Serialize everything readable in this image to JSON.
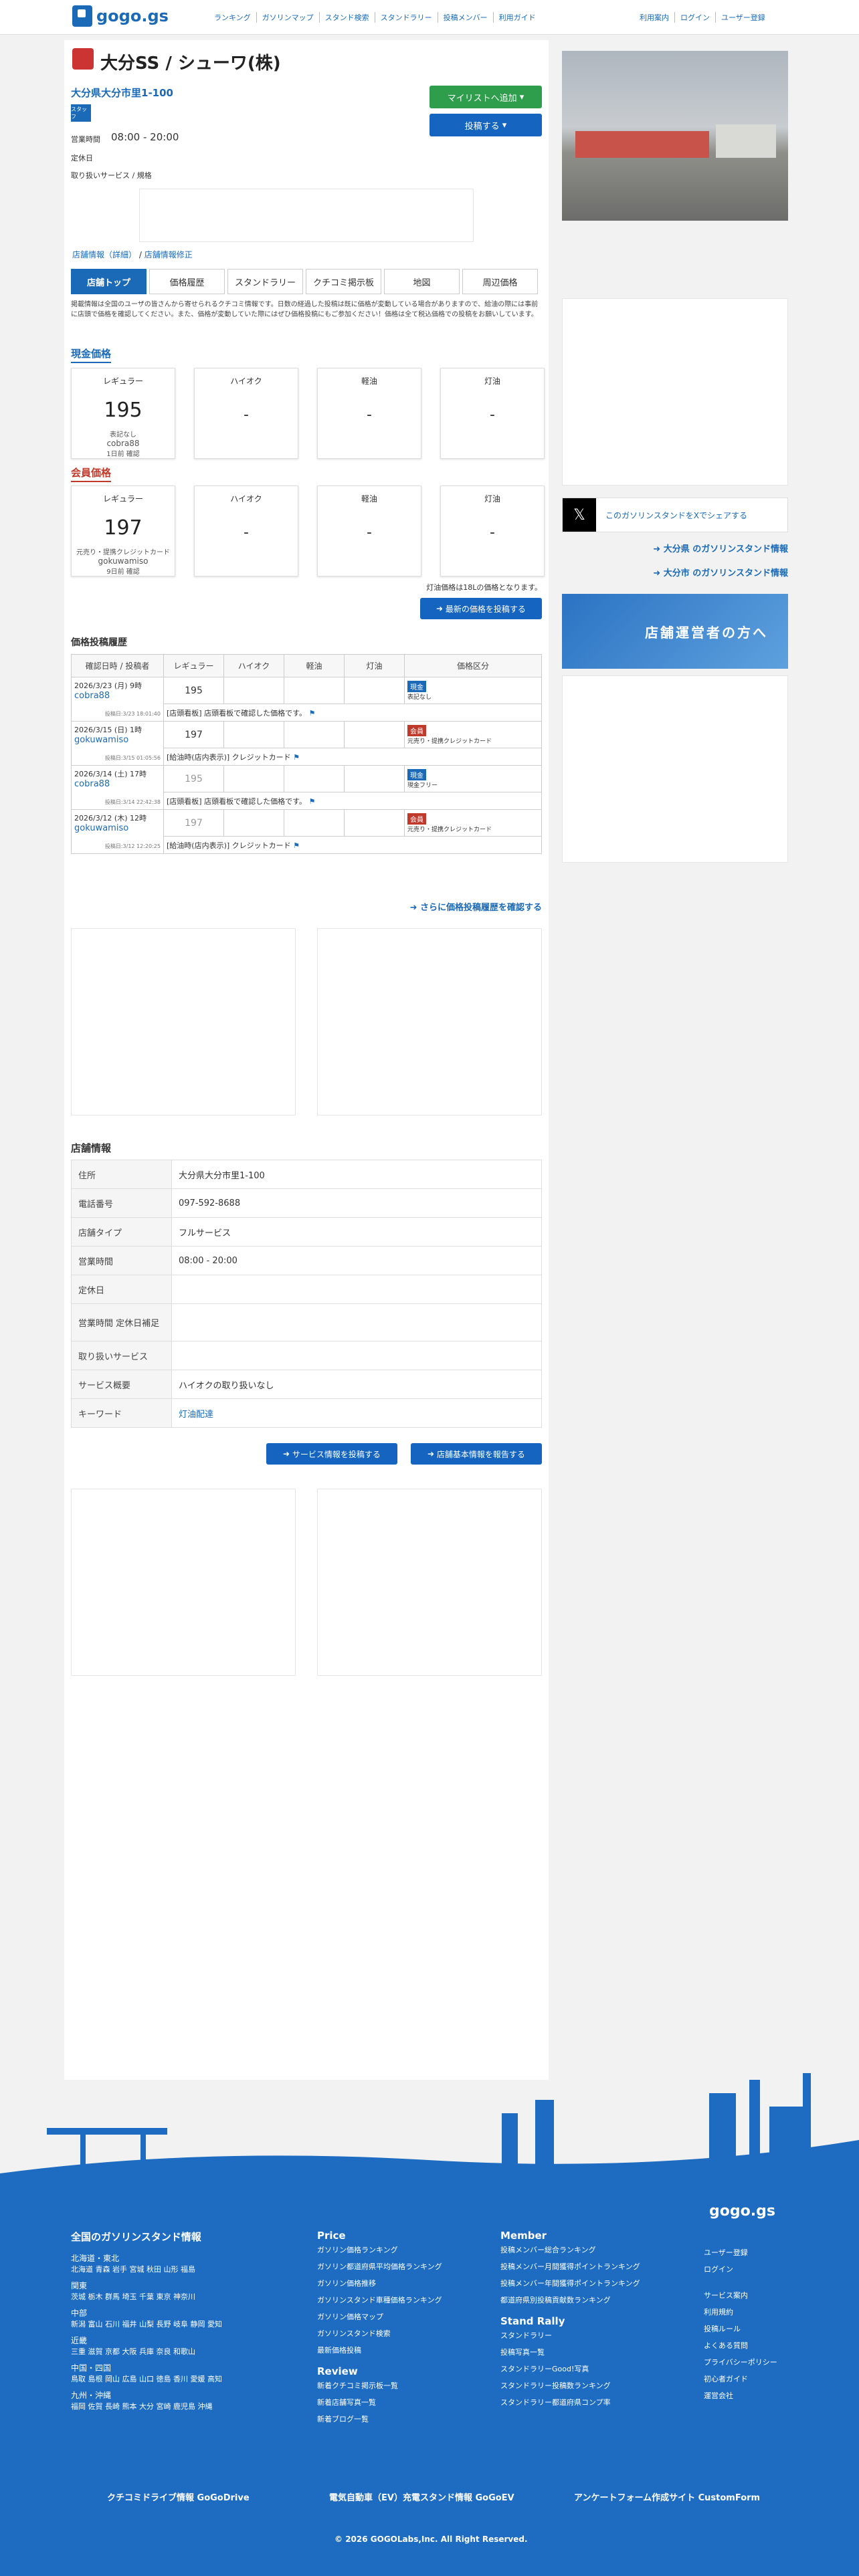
{
  "header": {
    "logo": "gogo.gs",
    "nav": [
      "ランキング",
      "ガソリンマップ",
      "スタンド検索",
      "スタンドラリー",
      "投稿メンバー",
      "利用ガイド"
    ],
    "right": [
      "利用案内",
      "ログイン",
      "ユーザー登録"
    ]
  },
  "station": {
    "name": "大分SS / シューワ(株)",
    "address": "大分県大分市里1-100",
    "hours_label": "営業時間",
    "hours": "08:00 - 20:00",
    "closed_label": "定休日",
    "services_label": "取り扱いサービス / 規格",
    "self_badge": "スタッフ"
  },
  "buttons": {
    "mylist": "マイリストへ追加",
    "post": "投稿する"
  },
  "breadcrumb": [
    "店舗情報（詳細）",
    "店舗情報修正"
  ],
  "tabs": [
    "店舗トップ",
    "価格履歴",
    "スタンドラリー",
    "クチコミ掲示板",
    "地図",
    "周辺価格"
  ],
  "notice": "掲載情報は全国のユーザの皆さんから寄せられるクチコミ情報です。日数の経過した投稿は既に価格が変動している場合がありますので、給油の際には事前に店頭で価格を確認してください。また、価格が変動していた際にはぜひ価格投稿にもご参加ください！価格は全て税込価格での投稿をお願いしています。",
  "cash": {
    "title": "現金価格",
    "cards": [
      {
        "label": "レギュラー",
        "price": "195",
        "note": "表記なし",
        "user": "cobra88",
        "when": "1日前 確認"
      },
      {
        "label": "ハイオク",
        "price": "-"
      },
      {
        "label": "軽油",
        "price": "-"
      },
      {
        "label": "灯油",
        "price": "-"
      }
    ]
  },
  "member": {
    "title": "会員価格",
    "cards": [
      {
        "label": "レギュラー",
        "price": "197",
        "note": "元売り・提携クレジットカード",
        "user": "gokuwamiso",
        "when": "9日前 確認"
      },
      {
        "label": "ハイオク",
        "price": "-"
      },
      {
        "label": "軽油",
        "price": "-"
      },
      {
        "label": "灯油",
        "price": "-"
      }
    ]
  },
  "kerosene_note": "灯油価格は18Lの価格となります。",
  "post_latest": "最新の価格を投稿する",
  "history": {
    "title": "価格投稿履歴",
    "headers": [
      "確認日時 / 投稿者",
      "レギュラー",
      "ハイオク",
      "軽油",
      "灯油",
      "価格区分"
    ],
    "rows": [
      {
        "date": "2026/3/23 (月) 9時",
        "user": "cobra88",
        "posted": "投稿日:3/23 18:01:40",
        "reg": "195",
        "badge": "現金",
        "btype": "blue",
        "bnote": "表記なし",
        "comment": "[店頭看板] 店頭看板で確認した価格です。"
      },
      {
        "date": "2026/3/15 (日) 1時",
        "user": "gokuwamiso",
        "posted": "投稿日:3/15 01:05:56",
        "reg": "197",
        "badge": "会員",
        "btype": "red",
        "bnote": "元売り・提携クレジットカード",
        "comment": "[給油時(店内表示)] クレジットカード"
      },
      {
        "date": "2026/3/14 (土) 17時",
        "user": "cobra88",
        "posted": "投稿日:3/14 22:42:38",
        "reg": "195",
        "badge": "現金",
        "btype": "blue",
        "bnote": "現金フリー",
        "comment": "[店頭看板] 店頭看板で確認した価格です。"
      },
      {
        "date": "2026/3/12 (木) 12時",
        "user": "gokuwamiso",
        "posted": "投稿日:3/12 12:20:25",
        "reg": "197",
        "badge": "会員",
        "btype": "red",
        "bnote": "元売り・提携クレジットカード",
        "comment": "[給油時(店内表示)] クレジットカード"
      }
    ],
    "more": "さらに価格投稿履歴を確認する"
  },
  "info": {
    "title": "店舗情報",
    "rows": [
      [
        "住所",
        "大分県大分市里1-100"
      ],
      [
        "電話番号",
        "097-592-8688"
      ],
      [
        "店舗タイプ",
        "フルサービス"
      ],
      [
        "営業時間",
        "08:00 - 20:00"
      ],
      [
        "定休日",
        ""
      ],
      [
        "営業時間 定休日補足",
        ""
      ],
      [
        "取り扱いサービス",
        ""
      ],
      [
        "サービス概要",
        "ハイオクの取り扱いなし"
      ],
      [
        "キーワード",
        "灯油配達"
      ]
    ]
  },
  "info_buttons": [
    "サービス情報を投稿する",
    "店舗基本情報を報告する"
  ],
  "side": {
    "share": "このガソリンスタンドをXでシェアする",
    "link1": "大分県 のガソリンスタンド情報",
    "link2": "大分市 のガソリンスタンド情報",
    "banner": "店舗運営者の方へ"
  },
  "footer": {
    "logo": "gogo.gs",
    "nation_title": "全国のガソリンスタンド情報",
    "regions": [
      {
        "name": "北海道・東北",
        "prefs": "北海道 青森 岩手 宮城 秋田 山形 福島"
      },
      {
        "name": "関東",
        "prefs": "茨城 栃木 群馬 埼玉 千葉 東京 神奈川"
      },
      {
        "name": "中部",
        "prefs": "新潟 富山 石川 福井 山梨 長野 岐阜 静岡 愛知"
      },
      {
        "name": "近畿",
        "prefs": "三重 滋賀 京都 大阪 兵庫 奈良 和歌山"
      },
      {
        "name": "中国・四国",
        "prefs": "鳥取 島根 岡山 広島 山口 徳島 香川 愛媛 高知"
      },
      {
        "name": "九州・沖縄",
        "prefs": "福岡 佐賀 長崎 熊本 大分 宮崎 鹿児島 沖縄"
      }
    ],
    "price_title": "Price",
    "price_links": [
      "ガソリン価格ランキング",
      "ガソリン都道府県平均価格ランキング",
      "ガソリン価格推移",
      "ガソリンスタンド車種価格ランキング",
      "ガソリン価格マップ",
      "ガソリンスタンド検索",
      "最新価格投稿"
    ],
    "review_title": "Review",
    "review_links": [
      "新着クチコミ掲示板一覧",
      "新着店舗写真一覧",
      "新着ブログ一覧"
    ],
    "member_title": "Member",
    "member_links": [
      "投稿メンバー総合ランキング",
      "投稿メンバー月間獲得ポイントランキング",
      "投稿メンバー年間獲得ポイントランキング",
      "都道府県別投稿貢献数ランキング"
    ],
    "rally_title": "Stand Rally",
    "rally_links": [
      "スタンドラリー",
      "投稿写真一覧",
      "スタンドラリーGood!写真",
      "スタンドラリー投稿数ランキング",
      "スタンドラリー都道府県コンプ率"
    ],
    "right_links": [
      "ユーザー登録",
      "ログイン",
      "",
      "サービス案内",
      "利用規約",
      "投稿ルール",
      "よくある質問",
      "プライバシーポリシー",
      "初心者ガイド",
      "運営会社"
    ],
    "bottom": [
      "クチコミドライブ情報 GoGoDrive",
      "電気自動車（EV）充電スタンド情報 GoGoEV",
      "アンケートフォーム作成サイト CustomForm"
    ],
    "copyright": "2026 GOGOLabs,Inc. All Right Reserved."
  }
}
